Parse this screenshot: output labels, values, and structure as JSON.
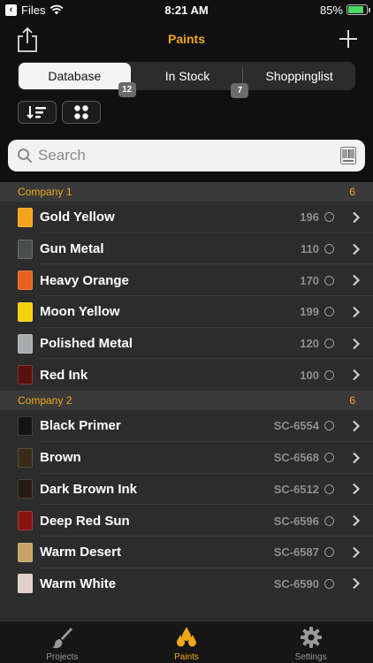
{
  "status_bar": {
    "back_app": "Files",
    "time": "8:21 AM",
    "battery": "85%",
    "battery_level": 0.85
  },
  "nav": {
    "title": "Paints"
  },
  "segments": [
    {
      "label": "Database",
      "badge": "12",
      "active": true
    },
    {
      "label": "In Stock",
      "badge": "7",
      "active": false
    },
    {
      "label": "Shoppinglist",
      "badge": "",
      "active": false
    }
  ],
  "search": {
    "placeholder": "Search"
  },
  "sections": [
    {
      "title": "Company 1",
      "count": "6",
      "items": [
        {
          "name": "Gold Yellow",
          "code": "196",
          "color": "#f5a31a"
        },
        {
          "name": "Gun Metal",
          "code": "110",
          "color": "#4a4c4e"
        },
        {
          "name": "Heavy Orange",
          "code": "170",
          "color": "#e8611c"
        },
        {
          "name": "Moon Yellow",
          "code": "199",
          "color": "#f5d10c"
        },
        {
          "name": "Polished Metal",
          "code": "120",
          "color": "#a9abad"
        },
        {
          "name": "Red Ink",
          "code": "100",
          "color": "#5a0f0c"
        }
      ]
    },
    {
      "title": "Company 2",
      "count": "6",
      "items": [
        {
          "name": "Black Primer",
          "code": "SC-6554",
          "color": "#141414"
        },
        {
          "name": "Brown",
          "code": "SC-6568",
          "color": "#3a2a18"
        },
        {
          "name": "Dark Brown Ink",
          "code": "SC-6512",
          "color": "#261a12"
        },
        {
          "name": "Deep Red Sun",
          "code": "SC-6596",
          "color": "#8a1210"
        },
        {
          "name": "Warm Desert",
          "code": "SC-6587",
          "color": "#c9a26a"
        },
        {
          "name": "Warm White",
          "code": "SC-6590",
          "color": "#e0d0c8"
        }
      ]
    }
  ],
  "tabs": [
    {
      "label": "Projects",
      "icon": "brush-icon",
      "active": false
    },
    {
      "label": "Paints",
      "icon": "drops-icon",
      "active": true
    },
    {
      "label": "Settings",
      "icon": "gear-icon",
      "active": false
    }
  ],
  "colors": {
    "accent": "#f0a818",
    "background": "#2c2c2c",
    "bar": "#101010"
  }
}
